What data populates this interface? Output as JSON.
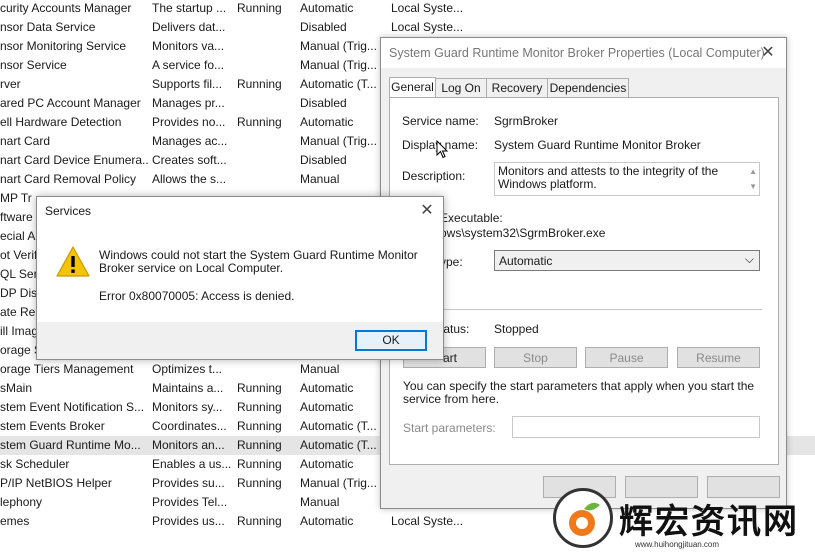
{
  "services": [
    {
      "name": "curity Accounts Manager",
      "desc": "The startup ...",
      "status": "Running",
      "startup": "Automatic",
      "logon": "Local Syste..."
    },
    {
      "name": "nsor Data Service",
      "desc": "Delivers dat...",
      "status": "",
      "startup": "Disabled",
      "logon": "Local Syste..."
    },
    {
      "name": "nsor Monitoring Service",
      "desc": "Monitors va...",
      "status": "",
      "startup": "Manual (Trig...",
      "logon": ""
    },
    {
      "name": "nsor Service",
      "desc": "A service fo...",
      "status": "",
      "startup": "Manual (Trig...",
      "logon": ""
    },
    {
      "name": "rver",
      "desc": "Supports fil...",
      "status": "Running",
      "startup": "Automatic (T...",
      "logon": ""
    },
    {
      "name": "ared PC Account Manager",
      "desc": "Manages pr...",
      "status": "",
      "startup": "Disabled",
      "logon": ""
    },
    {
      "name": "ell Hardware Detection",
      "desc": "Provides no...",
      "status": "Running",
      "startup": "Automatic",
      "logon": ""
    },
    {
      "name": "nart Card",
      "desc": "Manages ac...",
      "status": "",
      "startup": "Manual (Trig...",
      "logon": ""
    },
    {
      "name": "nart Card Device Enumera...",
      "desc": "Creates soft...",
      "status": "",
      "startup": "Disabled",
      "logon": ""
    },
    {
      "name": "nart Card Removal Policy",
      "desc": "Allows the s...",
      "status": "",
      "startup": "Manual",
      "logon": ""
    },
    {
      "name": "MP Tr",
      "desc": "",
      "status": "",
      "startup": "",
      "logon": ""
    },
    {
      "name": "ftware",
      "desc": "",
      "status": "",
      "startup": "",
      "logon": ""
    },
    {
      "name": "ecial A",
      "desc": "",
      "status": "",
      "startup": "",
      "logon": ""
    },
    {
      "name": "ot Verif",
      "desc": "",
      "status": "",
      "startup": "",
      "logon": ""
    },
    {
      "name": "QL Serv",
      "desc": "",
      "status": "",
      "startup": "",
      "logon": ""
    },
    {
      "name": "DP Dis",
      "desc": "",
      "status": "",
      "startup": "",
      "logon": ""
    },
    {
      "name": "ate Rep",
      "desc": "",
      "status": "",
      "startup": "",
      "logon": ""
    },
    {
      "name": "ill Imag",
      "desc": "",
      "status": "",
      "startup": "",
      "logon": ""
    },
    {
      "name": "orage S",
      "desc": "",
      "status": "",
      "startup": "",
      "logon": ""
    },
    {
      "name": "orage Tiers Management",
      "desc": "Optimizes t...",
      "status": "",
      "startup": "Manual",
      "logon": ""
    },
    {
      "name": "sMain",
      "desc": "Maintains a...",
      "status": "Running",
      "startup": "Automatic",
      "logon": ""
    },
    {
      "name": "stem Event Notification S...",
      "desc": "Monitors sy...",
      "status": "Running",
      "startup": "Automatic",
      "logon": ""
    },
    {
      "name": "stem Events Broker",
      "desc": "Coordinates...",
      "status": "Running",
      "startup": "Automatic (T...",
      "logon": ""
    },
    {
      "name": "stem Guard Runtime Mo...",
      "desc": "Monitors an...",
      "status": "Running",
      "startup": "Automatic (T...",
      "logon": ""
    },
    {
      "name": "sk Scheduler",
      "desc": "Enables a us...",
      "status": "Running",
      "startup": "Automatic",
      "logon": ""
    },
    {
      "name": "P/IP NetBIOS Helper",
      "desc": "Provides su...",
      "status": "Running",
      "startup": "Manual (Trig...",
      "logon": ""
    },
    {
      "name": "lephony",
      "desc": "Provides Tel...",
      "status": "",
      "startup": "Manual",
      "logon": ""
    },
    {
      "name": "emes",
      "desc": "Provides us...",
      "status": "Running",
      "startup": "Automatic",
      "logon": "Local Syste..."
    }
  ],
  "props": {
    "title": "System Guard Runtime Monitor Broker Properties (Local Computer)",
    "tabs": [
      "General",
      "Log On",
      "Recovery",
      "Dependencies"
    ],
    "service_name_label": "Service name:",
    "service_name": "SgrmBroker",
    "display_name_label": "Display name:",
    "display_name": "System Guard Runtime Monitor Broker",
    "description_label": "Description:",
    "description": "Monitors and attests to the integrity of the Windows platform.",
    "path_label": "Executable:",
    "path": "ows\\system32\\SgrmBroker.exe",
    "startup_label": "ype:",
    "startup": "Automatic",
    "status_label": "tatus:",
    "status": "Stopped",
    "start": "art",
    "stop": "Stop",
    "pause": "Pause",
    "resume": "Resume",
    "hint": "You can specify the start parameters that apply when you start the service from here.",
    "params_label": "Start parameters:"
  },
  "dialog": {
    "title": "Services",
    "message": "Windows could not start the System Guard Runtime Monitor Broker service on Local Computer.",
    "error": "Error 0x80070005: Access is denied.",
    "ok": "OK"
  },
  "watermark": {
    "text": "辉宏资讯网",
    "url": "www.huihongjituan.com"
  },
  "colors": {
    "accent": "#0078d7",
    "warning": "#f4c400"
  }
}
